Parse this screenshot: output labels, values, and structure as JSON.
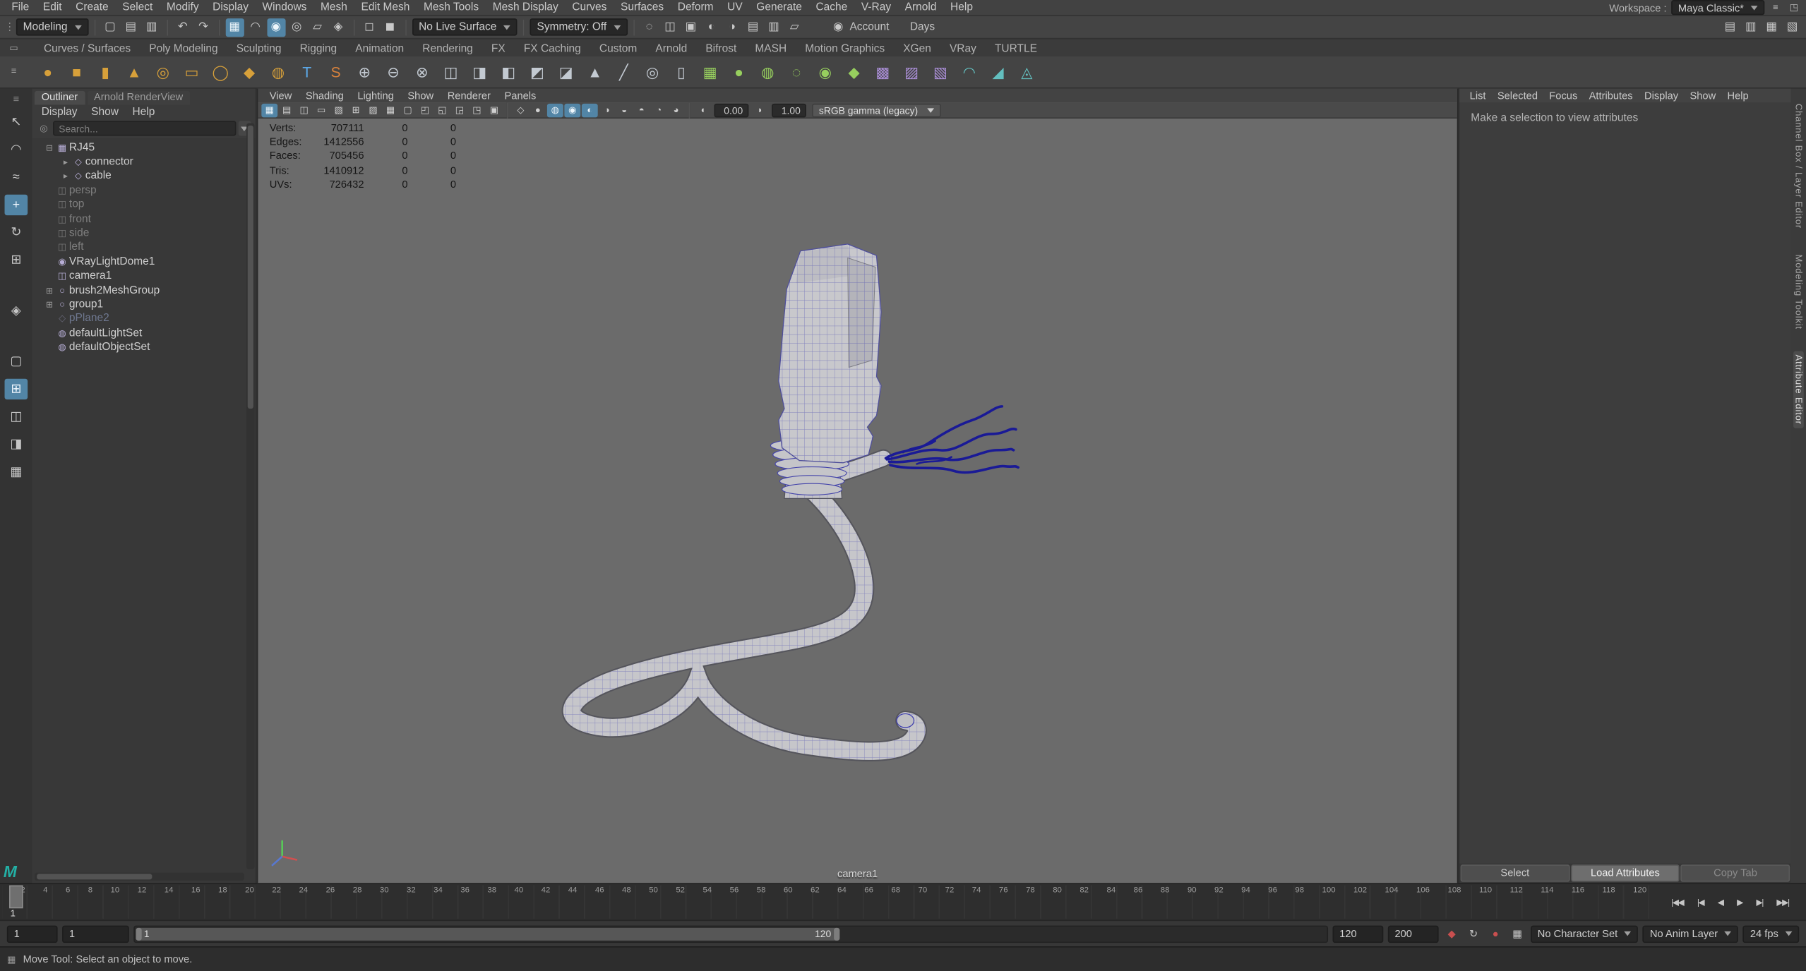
{
  "branding": {
    "maya_logo_text": "M"
  },
  "menubar": {
    "items": [
      "File",
      "Edit",
      "Create",
      "Select",
      "Modify",
      "Display",
      "Windows",
      "Mesh",
      "Edit Mesh",
      "Mesh Tools",
      "Mesh Display",
      "Curves",
      "Surfaces",
      "Deform",
      "UV",
      "Generate",
      "Cache",
      "V-Ray",
      "Arnold",
      "Help"
    ],
    "workspace_label": "Workspace :",
    "workspace_value": "Maya Classic*"
  },
  "toolbar": {
    "mode": "Modeling",
    "live_surface": "No Live Surface",
    "symmetry": "Symmetry: Off",
    "account": "Account",
    "days": "Days",
    "file_icons": [
      {
        "n": "new-scene-icon",
        "g": "▢"
      },
      {
        "n": "open-scene-icon",
        "g": "▤"
      },
      {
        "n": "save-scene-icon",
        "g": "▥"
      }
    ],
    "history_icons": [
      {
        "n": "undo-icon",
        "g": "↶"
      },
      {
        "n": "redo-icon",
        "g": "↷"
      }
    ],
    "snap_icons": [
      {
        "n": "snap-to-grid-icon",
        "g": "▦",
        "cls": "on"
      },
      {
        "n": "snap-to-curve-icon",
        "g": "◠"
      },
      {
        "n": "snap-to-point-icon",
        "g": "◉",
        "cls": "on"
      },
      {
        "n": "snap-to-projected-center-icon",
        "g": "◎"
      },
      {
        "n": "snap-to-view-plane-icon",
        "g": "▱"
      },
      {
        "n": "make-live-icon",
        "g": "◈"
      }
    ],
    "selection_icons": [
      {
        "n": "object-mode-icon",
        "g": "◻"
      },
      {
        "n": "component-mode-icon",
        "g": "◼"
      }
    ],
    "render_icons": [
      {
        "n": "soft-select-icon",
        "g": "◌"
      },
      {
        "n": "reflection-icon",
        "g": "◫"
      },
      {
        "n": "highlight-selection-icon",
        "g": "▣"
      },
      {
        "n": "render-current-frame-icon",
        "g": "◐"
      },
      {
        "n": "ipr-render-icon",
        "g": "◑"
      },
      {
        "n": "render-settings-icon",
        "g": "▤"
      },
      {
        "n": "hypershade-icon",
        "g": "▥"
      },
      {
        "n": "toggle-viewport-icon",
        "g": "▱"
      }
    ],
    "sidebar_icons": [
      {
        "n": "channel-box-toggle-icon",
        "g": "▤"
      },
      {
        "n": "attribute-editor-toggle-icon",
        "g": "▥"
      },
      {
        "n": "tool-settings-toggle-icon",
        "g": "▦"
      },
      {
        "n": "modeling-toolkit-toggle-icon",
        "g": "▧"
      }
    ]
  },
  "shelf": {
    "tabs": [
      "Curves / Surfaces",
      "Poly Modeling",
      "Sculpting",
      "Rigging",
      "Animation",
      "Rendering",
      "FX",
      "FX Caching",
      "Custom",
      "Arnold",
      "Bifrost",
      "MASH",
      "Motion Graphics",
      "XGen",
      "VRay",
      "TURTLE"
    ],
    "active_tab": "Poly Modeling",
    "icons": [
      {
        "n": "shelf-poly-sphere-icon",
        "g": "●",
        "cls": "gold"
      },
      {
        "n": "shelf-poly-cube-icon",
        "g": "■",
        "cls": "gold"
      },
      {
        "n": "shelf-poly-cylinder-icon",
        "g": "▮",
        "cls": "gold"
      },
      {
        "n": "shelf-poly-cone-icon",
        "g": "▲",
        "cls": "gold"
      },
      {
        "n": "shelf-poly-torus-icon",
        "g": "◎",
        "cls": "gold"
      },
      {
        "n": "shelf-poly-plane-icon",
        "g": "▭",
        "cls": "gold"
      },
      {
        "n": "shelf-poly-disc-icon",
        "g": "◯",
        "cls": "gold"
      },
      {
        "n": "shelf-platonic-solid-icon",
        "g": "◆",
        "cls": "gold"
      },
      {
        "n": "shelf-super-ellipse-icon",
        "g": "◍",
        "cls": "gold"
      },
      {
        "n": "shelf-type-tool-icon",
        "g": "T",
        "cls": "blue"
      },
      {
        "n": "shelf-svg-tool-icon",
        "g": "S",
        "cls": "orange"
      },
      {
        "n": "shelf-boolean-union-icon",
        "g": "⊕",
        "cls": "gray"
      },
      {
        "n": "shelf-boolean-difference-icon",
        "g": "⊖",
        "cls": "gray"
      },
      {
        "n": "shelf-boolean-intersection-icon",
        "g": "⊗",
        "cls": "gray"
      },
      {
        "n": "shelf-combine-icon",
        "g": "◫",
        "cls": "gray"
      },
      {
        "n": "shelf-separate-icon",
        "g": "◨",
        "cls": "gray"
      },
      {
        "n": "shelf-extract-icon",
        "g": "◧",
        "cls": "gray"
      },
      {
        "n": "shelf-bevel-icon",
        "g": "◩",
        "cls": "gray"
      },
      {
        "n": "shelf-bridge-icon",
        "g": "◪",
        "cls": "gray"
      },
      {
        "n": "shelf-extrude-icon",
        "g": "▲",
        "cls": "gray"
      },
      {
        "n": "shelf-multi-cut-icon",
        "g": "╱",
        "cls": "gray"
      },
      {
        "n": "shelf-target-weld-icon",
        "g": "◎",
        "cls": "gray"
      },
      {
        "n": "shelf-mirror-icon",
        "g": "▯",
        "cls": "gray"
      },
      {
        "n": "shelf-quad-draw-icon",
        "g": "▦",
        "cls": "green"
      },
      {
        "n": "shelf-sculpt-brush-icon",
        "g": "●",
        "cls": "green"
      },
      {
        "n": "shelf-smooth-brush-icon",
        "g": "◍",
        "cls": "green"
      },
      {
        "n": "shelf-relax-brush-icon",
        "g": "◌",
        "cls": "green"
      },
      {
        "n": "shelf-grab-brush-icon",
        "g": "◉",
        "cls": "green"
      },
      {
        "n": "shelf-pinch-brush-icon",
        "g": "◆",
        "cls": "green"
      },
      {
        "n": "shelf-remesh-icon",
        "g": "▩",
        "cls": "purple"
      },
      {
        "n": "shelf-retopologize-icon",
        "g": "▨",
        "cls": "purple"
      },
      {
        "n": "shelf-reduce-icon",
        "g": "▧",
        "cls": "purple"
      },
      {
        "n": "shelf-smooth-mesh-icon",
        "g": "◠",
        "cls": "teal"
      },
      {
        "n": "shelf-crease-icon",
        "g": "◢",
        "cls": "teal"
      },
      {
        "n": "shelf-spin-edge-icon",
        "g": "◬",
        "cls": "teal"
      }
    ]
  },
  "toolbox": {
    "tools": [
      {
        "n": "select-tool-icon",
        "g": "↖"
      },
      {
        "n": "lasso-tool-icon",
        "g": "◠"
      },
      {
        "n": "paint-select-tool-icon",
        "g": "≈"
      },
      {
        "n": "move-tool-icon",
        "g": "+",
        "cls": "active"
      },
      {
        "n": "rotate-tool-icon",
        "g": "↻"
      },
      {
        "n": "scale-tool-icon",
        "g": "⊞"
      }
    ],
    "layouts": [
      {
        "n": "layout-single-pane-icon",
        "g": "▢"
      },
      {
        "n": "layout-four-pane-icon",
        "g": "⊞",
        "cls": "active"
      },
      {
        "n": "layout-two-pane-icon",
        "g": "◫"
      },
      {
        "n": "layout-persp-outliner-icon",
        "g": "◨"
      },
      {
        "n": "layout-custom-icon",
        "g": "▦"
      }
    ]
  },
  "outliner": {
    "tabs": [
      "Outliner",
      "Arnold RenderView"
    ],
    "menus": [
      "Display",
      "Show",
      "Help"
    ],
    "search_placeholder": "Search...",
    "items": [
      {
        "label": "RJ45",
        "g": "▦",
        "exp": "⊟",
        "cls": "d0",
        "n": "outliner-item-rj45"
      },
      {
        "label": "connector",
        "g": "◇",
        "exp": "▸",
        "cls": "d1",
        "n": "outliner-item-connector"
      },
      {
        "label": "cable",
        "g": "◇",
        "exp": "▸",
        "cls": "d1",
        "n": "outliner-item-cable"
      },
      {
        "label": "persp",
        "g": "◫",
        "exp": "",
        "cls": "d0 dim",
        "n": "outliner-item-persp"
      },
      {
        "label": "top",
        "g": "◫",
        "exp": "",
        "cls": "d0 dim",
        "n": "outliner-item-top"
      },
      {
        "label": "front",
        "g": "◫",
        "exp": "",
        "cls": "d0 dim",
        "n": "outliner-item-front"
      },
      {
        "label": "side",
        "g": "◫",
        "exp": "",
        "cls": "d0 dim",
        "n": "outliner-item-side"
      },
      {
        "label": "left",
        "g": "◫",
        "exp": "",
        "cls": "d0 dim",
        "n": "outliner-item-left"
      },
      {
        "label": "VRayLightDome1",
        "g": "◉",
        "exp": "",
        "cls": "d0",
        "n": "outliner-item-vraylightdome1"
      },
      {
        "label": "camera1",
        "g": "◫",
        "exp": "",
        "cls": "d0",
        "n": "outliner-item-camera1"
      },
      {
        "label": "brush2MeshGroup",
        "g": "○",
        "exp": "⊞",
        "cls": "d0",
        "n": "outliner-item-brush2meshgroup"
      },
      {
        "label": "group1",
        "g": "○",
        "exp": "⊞",
        "cls": "d0",
        "n": "outliner-item-group1"
      },
      {
        "label": "pPlane2",
        "g": "◇",
        "exp": "",
        "cls": "d0 ghost",
        "n": "outliner-item-pplane2"
      },
      {
        "label": "defaultLightSet",
        "g": "◍",
        "exp": "",
        "cls": "d0",
        "n": "outliner-item-defaultlightset"
      },
      {
        "label": "defaultObjectSet",
        "g": "◍",
        "exp": "",
        "cls": "d0",
        "n": "outliner-item-defaultobjectset"
      }
    ]
  },
  "viewport": {
    "menus": [
      "View",
      "Shading",
      "Lighting",
      "Show",
      "Renderer",
      "Panels"
    ],
    "icons_a": [
      {
        "n": "select-camera-icon",
        "g": "▦",
        "cls": "on"
      },
      {
        "n": "lock-camera-icon",
        "g": "▤"
      },
      {
        "n": "camera-attributes-icon",
        "g": "◫"
      },
      {
        "n": "bookmark-icon",
        "g": "▭"
      },
      {
        "n": "image-plane-icon",
        "g": "▧"
      },
      {
        "n": "pan-zoom-2d-icon",
        "g": "⊞"
      },
      {
        "n": "oversample-icon",
        "g": "▨"
      },
      {
        "n": "grid-toggle-icon",
        "g": "▦"
      },
      {
        "n": "film-gate-icon",
        "g": "▢"
      },
      {
        "n": "resolution-gate-icon",
        "g": "◰"
      },
      {
        "n": "gate-mask-icon",
        "g": "◱"
      },
      {
        "n": "field-chart-icon",
        "g": "◲"
      },
      {
        "n": "safe-action-icon",
        "g": "◳"
      },
      {
        "n": "safe-title-icon",
        "g": "▣"
      }
    ],
    "icons_b": [
      {
        "n": "wireframe-display-icon",
        "g": "◇"
      },
      {
        "n": "shaded-display-icon",
        "g": "●"
      },
      {
        "n": "textured-display-icon",
        "g": "◍",
        "cls": "on"
      },
      {
        "n": "lights-display-icon",
        "g": "◉",
        "cls": "on"
      },
      {
        "n": "shadows-display-icon",
        "g": "◐",
        "cls": "on"
      },
      {
        "n": "ambient-occlusion-icon",
        "g": "◑"
      },
      {
        "n": "motion-blur-icon",
        "g": "◒"
      },
      {
        "n": "multisample-aa-icon",
        "g": "◓"
      },
      {
        "n": "xray-display-icon",
        "g": "◔"
      },
      {
        "n": "isolate-select-icon",
        "g": "◕"
      }
    ],
    "exposure_value": "0.00",
    "gamma_value": "1.00",
    "view_transform": "sRGB gamma (legacy)",
    "hud": [
      {
        "label": "Verts:",
        "value": "707111",
        "c1": "0",
        "c2": "0"
      },
      {
        "label": "Edges:",
        "value": "1412556",
        "c1": "0",
        "c2": "0"
      },
      {
        "label": "Faces:",
        "value": "705456",
        "c1": "0",
        "c2": "0"
      },
      {
        "label": "Tris:",
        "value": "1410912",
        "c1": "0",
        "c2": "0"
      },
      {
        "label": "UVs:",
        "value": "726432",
        "c1": "0",
        "c2": "0"
      }
    ],
    "camera_label": "camera1"
  },
  "attribute_editor": {
    "menus": [
      "List",
      "Selected",
      "Focus",
      "Attributes",
      "Display",
      "Show",
      "Help"
    ],
    "message": "Make a selection to view attributes",
    "buttons": [
      {
        "label": "Select",
        "n": "select-button",
        "cls": ""
      },
      {
        "label": "Load Attributes",
        "n": "load-attributes-button",
        "cls": "primary"
      },
      {
        "label": "Copy Tab",
        "n": "copy-tab-button",
        "cls": "dim"
      }
    ]
  },
  "side_tabs": [
    {
      "label": "Channel Box / Layer Editor",
      "n": "side-tab-channel-box",
      "cls": ""
    },
    {
      "label": "Modeling Toolkit",
      "n": "side-tab-modeling-toolkit",
      "cls": ""
    },
    {
      "label": "Attribute Editor",
      "n": "side-tab-attribute-editor",
      "cls": "active"
    }
  ],
  "timeline": {
    "ticks": [
      "2",
      "4",
      "6",
      "8",
      "10",
      "12",
      "14",
      "16",
      "18",
      "20",
      "22",
      "24",
      "26",
      "28",
      "30",
      "32",
      "34",
      "36",
      "38",
      "40",
      "42",
      "44",
      "46",
      "48",
      "50",
      "52",
      "54",
      "56",
      "58",
      "60",
      "62",
      "64",
      "66",
      "68",
      "70",
      "72",
      "74",
      "76",
      "78",
      "80",
      "82",
      "84",
      "86",
      "88",
      "90",
      "92",
      "94",
      "96",
      "98",
      "100",
      "102",
      "104",
      "106",
      "108",
      "110",
      "112",
      "114",
      "116",
      "118",
      "120"
    ],
    "current_frame": "1",
    "playback": [
      {
        "n": "go-to-start-button",
        "g": "|◀◀"
      },
      {
        "n": "prev-key-button",
        "g": "|◀"
      },
      {
        "n": "step-back-button",
        "g": "◀"
      },
      {
        "n": "play-forward-button",
        "g": "▶"
      },
      {
        "n": "step-forward-button",
        "g": "▶|"
      },
      {
        "n": "go-to-end-button",
        "g": "▶▶|"
      }
    ]
  },
  "range_bar": {
    "field_min": "1",
    "field_start": "1",
    "bar_start": "1",
    "bar_end": "120",
    "field_end": "120",
    "field_max": "200",
    "character_set": "No Character Set",
    "anim_layer": "No Anim Layer",
    "fps": "24 fps",
    "icons": [
      {
        "n": "set-key-icon",
        "g": "◆",
        "cls": "red"
      },
      {
        "n": "playback-loop-icon",
        "g": "↻"
      },
      {
        "n": "auto-key-icon",
        "g": "●",
        "cls": "red"
      },
      {
        "n": "anim-preferences-icon",
        "g": "▦"
      }
    ]
  },
  "helpline": {
    "text": "Move Tool: Select an object to move."
  }
}
